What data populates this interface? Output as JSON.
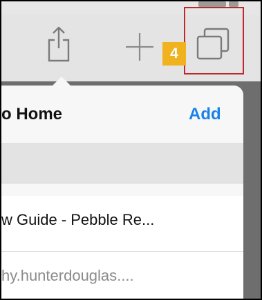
{
  "tutorial": {
    "step_badge": "4",
    "highlight_color": "#c0272d",
    "badge_color": "#f0b21e"
  },
  "toolbar": {
    "share_icon": "share-icon",
    "new_tab_icon": "plus-icon",
    "tabs_icon": "tabs-icon"
  },
  "popover": {
    "title": "o Home",
    "add_label": "Add",
    "accent_color": "#1a82e8",
    "page_title_value": "w Guide - Pebble Re...",
    "page_url_value": "hy.hunterdouglas...."
  }
}
